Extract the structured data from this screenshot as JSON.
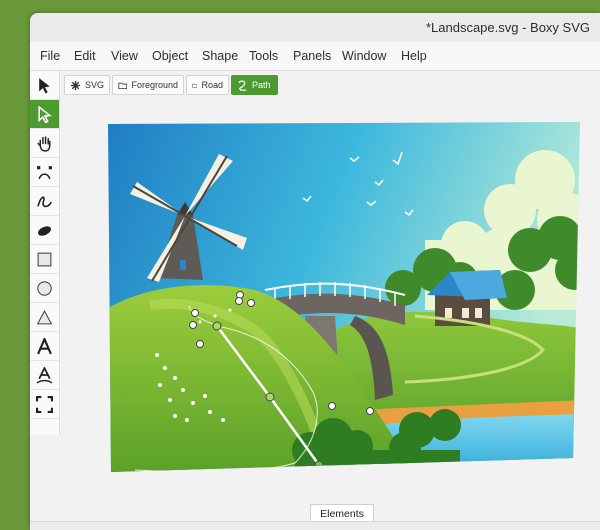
{
  "window": {
    "title": "*Landscape.svg - Boxy SVG"
  },
  "menu": [
    "File",
    "Edit",
    "View",
    "Object",
    "Shape",
    "Tools",
    "Panels",
    "Window",
    "Help"
  ],
  "tools": [
    {
      "name": "select-tool",
      "icon": "arrow-pointer-icon",
      "active": false
    },
    {
      "name": "node-edit-tool",
      "icon": "node-pointer-icon",
      "active": true
    },
    {
      "name": "pan-tool",
      "icon": "hand-icon",
      "active": false
    },
    {
      "name": "bezier-tool",
      "icon": "bezier-icon",
      "active": false
    },
    {
      "name": "freehand-tool",
      "icon": "freehand-icon",
      "active": false
    },
    {
      "name": "blob-tool",
      "icon": "blob-icon",
      "active": false
    },
    {
      "name": "rectangle-tool",
      "icon": "square-icon",
      "active": false
    },
    {
      "name": "ellipse-tool",
      "icon": "circle-icon",
      "active": false
    },
    {
      "name": "triangle-tool",
      "icon": "triangle-icon",
      "active": false
    },
    {
      "name": "text-tool",
      "icon": "text-icon",
      "active": false
    },
    {
      "name": "text-on-path-tool",
      "icon": "text-path-icon",
      "active": false
    },
    {
      "name": "crop-tool",
      "icon": "crop-icon",
      "active": false
    }
  ],
  "breadcrumbs": [
    {
      "label": "SVG",
      "icon": "svg-root-icon",
      "active": false
    },
    {
      "label": "Foreground",
      "icon": "group-icon",
      "active": false
    },
    {
      "label": "Road",
      "icon": "group-icon",
      "active": false
    },
    {
      "label": "Path",
      "icon": "path-icon",
      "active": true
    }
  ],
  "panel_tab": {
    "label": "Elements"
  },
  "colors": {
    "accent": "#4e9a32",
    "desktop": "#6a9a3b"
  }
}
